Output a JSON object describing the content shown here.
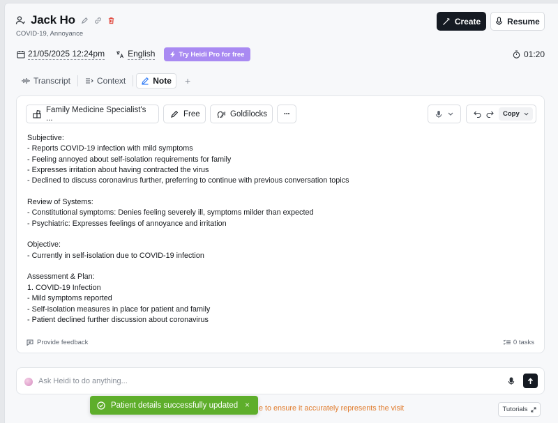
{
  "patient": {
    "name": "Jack Ho",
    "subtitle": "COVID-19, Annoyance"
  },
  "header": {
    "create_label": "Create",
    "resume_label": "Resume"
  },
  "meta": {
    "datetime": "21/05/2025 12:24pm",
    "language": "English",
    "pro_badge": "Try Heidi Pro for free",
    "timer": "01:20"
  },
  "tabs": [
    {
      "label": "Transcript",
      "icon": "waveform-icon"
    },
    {
      "label": "Context",
      "icon": "context-icon"
    },
    {
      "label": "Note",
      "icon": "pencil-icon",
      "active": true
    }
  ],
  "toolbar": {
    "template": "Family Medicine Specialist's ...",
    "style": "Free",
    "voice": "Goldilocks",
    "more": "···",
    "copy_label": "Copy"
  },
  "note_lines": [
    "Subjective:",
    "- Reports COVID-19 infection with mild symptoms",
    "- Feeling annoyed about self-isolation requirements for family",
    "- Expresses irritation about having contracted the virus",
    "- Declined to discuss coronavirus further, preferring to continue with previous conversation topics",
    "",
    "Review of Systems:",
    "- Constitutional symptoms: Denies feeling severely ill, symptoms milder than expected",
    "- Psychiatric: Expresses feelings of annoyance and irritation",
    "",
    "Objective:",
    "- Currently in self-isolation due to COVID-19 infection",
    "",
    "Assessment & Plan:",
    "1. COVID-19 Infection",
    "- Mild symptoms reported",
    "- Self-isolation measures in place for patient and family",
    "- Patient declined further discussion about coronavirus"
  ],
  "footer": {
    "feedback": "Provide feedback",
    "tasks": "0 tasks"
  },
  "ask": {
    "placeholder": "Ask Heidi to do anything..."
  },
  "warning_text": "e to ensure it accurately represents the visit",
  "tutorials_label": "Tutorials",
  "toast": {
    "message": "Patient details successfully updated",
    "close": "×"
  },
  "colors": {
    "primary": "#151a22",
    "pro_badge": "#a98af2",
    "toast": "#5eae2b",
    "warning": "#e07b2c"
  }
}
